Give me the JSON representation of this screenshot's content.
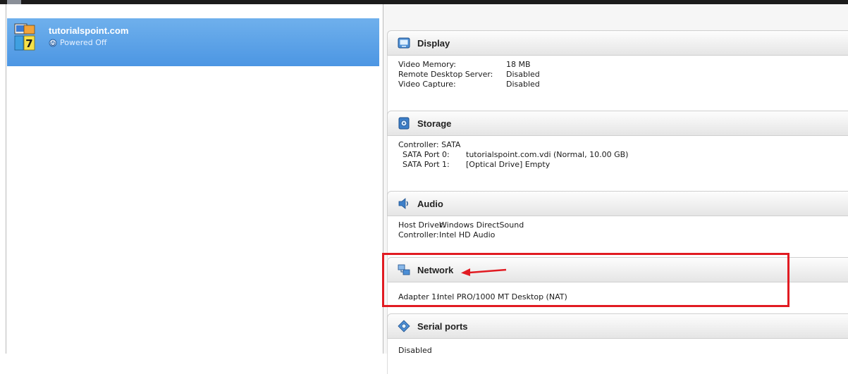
{
  "vm_list": {
    "selected": {
      "name": "tutorialspoint.com",
      "state": "Powered Off"
    }
  },
  "details": {
    "display": {
      "title": "Display",
      "rows": [
        {
          "label": "Video Memory:",
          "value": "18 MB"
        },
        {
          "label": "Remote Desktop Server:",
          "value": "Disabled"
        },
        {
          "label": "Video Capture:",
          "value": "Disabled"
        }
      ]
    },
    "storage": {
      "title": "Storage",
      "controller": "Controller: SATA",
      "rows": [
        {
          "label": "SATA Port 0:",
          "value": "tutorialspoint.com.vdi (Normal, 10.00 GB)"
        },
        {
          "label": "SATA Port 1:",
          "value": "[Optical Drive] Empty"
        }
      ]
    },
    "audio": {
      "title": "Audio",
      "rows": [
        {
          "label": "Host Driver:",
          "value": "Windows DirectSound"
        },
        {
          "label": "Controller:",
          "value": "Intel HD Audio"
        }
      ]
    },
    "network": {
      "title": "Network",
      "rows": [
        {
          "label": "Adapter 1:",
          "value": "Intel PRO/1000 MT Desktop (NAT)"
        }
      ]
    },
    "serial_ports": {
      "title": "Serial ports",
      "body": "Disabled"
    }
  },
  "colors": {
    "selection": "#4c96e3",
    "highlight_box": "#e11b22"
  },
  "icons": {
    "vm": "windows7-vm-icon",
    "state": "powered-off-icon",
    "display": "monitor-icon",
    "storage": "disk-icon",
    "audio": "speaker-icon",
    "network": "network-icon",
    "serial_ports": "serial-port-icon",
    "annotation": "red-arrow-icon"
  }
}
